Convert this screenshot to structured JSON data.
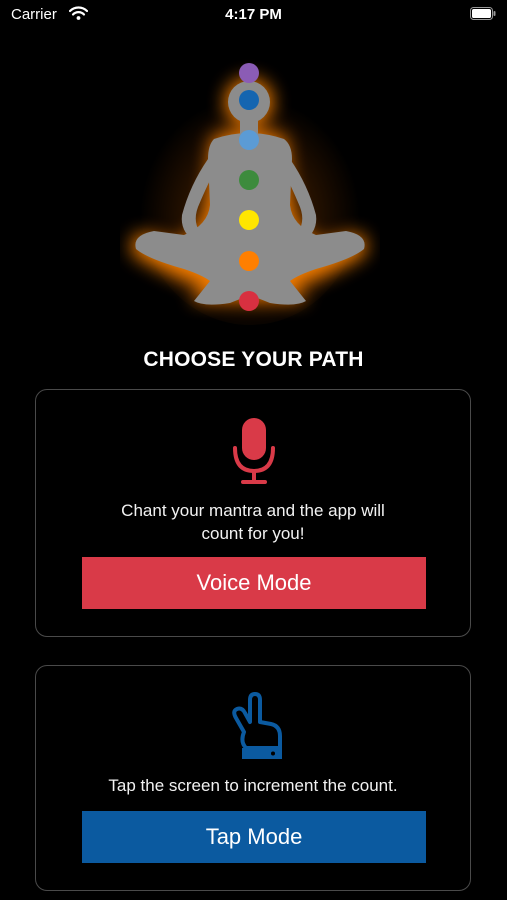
{
  "status_bar": {
    "carrier": "Carrier",
    "time": "4:17 PM"
  },
  "heading": "CHOOSE YOUR PATH",
  "voice_card": {
    "icon": "microphone-icon",
    "description_line1": "Chant your mantra and the app will",
    "description_line2": "count for you!",
    "button_label": "Voice Mode",
    "color": "#d93a48"
  },
  "tap_card": {
    "icon": "tap-hand-icon",
    "description": "Tap the screen to increment the count.",
    "button_label": "Tap Mode",
    "color": "#0b5aa0"
  },
  "hero": {
    "icon": "meditation-chakra-figure",
    "chakra_colors": [
      "#8b5cb5",
      "#1565b0",
      "#5b9bd5",
      "#3d8b3d",
      "#ffe600",
      "#ff7f00",
      "#d83040"
    ]
  }
}
